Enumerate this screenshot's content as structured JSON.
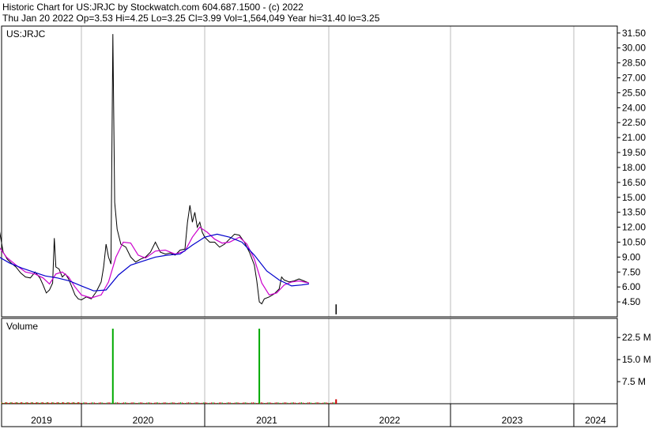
{
  "header": {
    "line1": "Historic Chart for US:JRJC by Stockwatch.com 604.687.1500 - (c) 2022",
    "line2": "Thu Jan 20 2022   Op=3.53   Hi=4.25   Lo=3.25   Cl=3.99   Vol=1,564,049   Year hi=31.40   lo=3.25"
  },
  "colors": {
    "price": "#000000",
    "ma_short": "#cc00cc",
    "ma_long": "#0000cc",
    "volume": "#00aa00",
    "volume_small": "#cc0000",
    "grid": "#bbbbbb"
  },
  "chart_data": [
    {
      "type": "line",
      "panel_label": "US:JRJC",
      "y_ticks": [
        "31.50",
        "30.00",
        "28.50",
        "27.00",
        "25.50",
        "24.00",
        "22.50",
        "21.00",
        "19.50",
        "18.00",
        "16.50",
        "15.00",
        "13.50",
        "12.00",
        "10.50",
        "9.00",
        "7.50",
        "6.00",
        "4.50"
      ],
      "ylim": [
        3.0,
        32.2
      ],
      "x_ticks": [
        "2019",
        "2020",
        "2021",
        "2022",
        "2023",
        "2024"
      ],
      "series": [
        {
          "values": [
            [
              2018.97,
              11.8
            ],
            [
              2019.02,
              9.5
            ],
            [
              2019.07,
              8.8
            ],
            [
              2019.12,
              8.4
            ],
            [
              2019.18,
              8.0
            ],
            [
              2019.24,
              7.4
            ],
            [
              2019.3,
              7.0
            ],
            [
              2019.36,
              6.9
            ],
            [
              2019.42,
              7.5
            ],
            [
              2019.48,
              6.9
            ],
            [
              2019.52,
              6.2
            ],
            [
              2019.56,
              5.4
            ],
            [
              2019.6,
              5.7
            ],
            [
              2019.64,
              6.4
            ],
            [
              2019.66,
              10.9
            ],
            [
              2019.68,
              8.0
            ],
            [
              2019.72,
              7.8
            ],
            [
              2019.76,
              7.0
            ],
            [
              2019.8,
              7.3
            ],
            [
              2019.84,
              6.8
            ],
            [
              2019.88,
              6.0
            ],
            [
              2019.92,
              5.2
            ],
            [
              2019.96,
              4.8
            ],
            [
              2020.0,
              4.7
            ],
            [
              2020.04,
              5.0
            ],
            [
              2020.08,
              4.8
            ],
            [
              2020.12,
              5.5
            ],
            [
              2020.16,
              6.5
            ],
            [
              2020.18,
              8.0
            ],
            [
              2020.2,
              10.3
            ],
            [
              2020.22,
              9.0
            ],
            [
              2020.24,
              8.3
            ],
            [
              2020.255,
              31.4
            ],
            [
              2020.27,
              14.5
            ],
            [
              2020.29,
              11.8
            ],
            [
              2020.32,
              10.3
            ],
            [
              2020.36,
              10.0
            ],
            [
              2020.4,
              9.0
            ],
            [
              2020.44,
              8.5
            ],
            [
              2020.48,
              8.8
            ],
            [
              2020.52,
              9.0
            ],
            [
              2020.56,
              9.5
            ],
            [
              2020.6,
              10.5
            ],
            [
              2020.64,
              9.5
            ],
            [
              2020.68,
              9.3
            ],
            [
              2020.72,
              9.4
            ],
            [
              2020.76,
              9.2
            ],
            [
              2020.8,
              9.7
            ],
            [
              2020.84,
              9.8
            ],
            [
              2020.86,
              12.5
            ],
            [
              2020.88,
              14.2
            ],
            [
              2020.9,
              12.5
            ],
            [
              2020.92,
              13.5
            ],
            [
              2020.94,
              12.0
            ],
            [
              2020.96,
              12.5
            ],
            [
              2020.98,
              11.5
            ],
            [
              2021.0,
              11.0
            ],
            [
              2021.04,
              10.5
            ],
            [
              2021.08,
              10.5
            ],
            [
              2021.12,
              10.0
            ],
            [
              2021.16,
              10.3
            ],
            [
              2021.2,
              10.8
            ],
            [
              2021.24,
              11.3
            ],
            [
              2021.28,
              11.2
            ],
            [
              2021.32,
              10.5
            ],
            [
              2021.36,
              9.5
            ],
            [
              2021.4,
              8.2
            ],
            [
              2021.42,
              6.6
            ],
            [
              2021.44,
              4.5
            ],
            [
              2021.46,
              4.3
            ],
            [
              2021.48,
              4.8
            ],
            [
              2021.52,
              5.0
            ],
            [
              2021.56,
              5.3
            ],
            [
              2021.6,
              5.8
            ],
            [
              2021.62,
              7.0
            ],
            [
              2021.64,
              6.7
            ],
            [
              2021.68,
              6.5
            ],
            [
              2021.72,
              6.6
            ],
            [
              2021.76,
              6.8
            ],
            [
              2021.8,
              6.6
            ],
            [
              2021.84,
              6.4
            ]
          ]
        },
        {
          "values": [
            [
              2018.97,
              10.0
            ],
            [
              2019.06,
              9.0
            ],
            [
              2019.18,
              8.2
            ],
            [
              2019.3,
              7.5
            ],
            [
              2019.42,
              7.3
            ],
            [
              2019.52,
              6.9
            ],
            [
              2019.6,
              6.3
            ],
            [
              2019.68,
              7.3
            ],
            [
              2019.76,
              7.5
            ],
            [
              2019.84,
              7.0
            ],
            [
              2019.92,
              6.0
            ],
            [
              2020.0,
              5.2
            ],
            [
              2020.08,
              4.9
            ],
            [
              2020.16,
              5.2
            ],
            [
              2020.22,
              6.5
            ],
            [
              2020.28,
              9.0
            ],
            [
              2020.34,
              10.5
            ],
            [
              2020.4,
              10.4
            ],
            [
              2020.46,
              9.2
            ],
            [
              2020.52,
              8.9
            ],
            [
              2020.6,
              9.6
            ],
            [
              2020.68,
              9.7
            ],
            [
              2020.76,
              9.3
            ],
            [
              2020.84,
              9.6
            ],
            [
              2020.9,
              11.0
            ],
            [
              2020.96,
              12.0
            ],
            [
              2021.02,
              11.5
            ],
            [
              2021.08,
              10.8
            ],
            [
              2021.14,
              10.4
            ],
            [
              2021.2,
              10.5
            ],
            [
              2021.28,
              11.0
            ],
            [
              2021.34,
              10.3
            ],
            [
              2021.4,
              8.8
            ],
            [
              2021.46,
              6.4
            ],
            [
              2021.52,
              5.2
            ],
            [
              2021.58,
              5.4
            ],
            [
              2021.64,
              6.2
            ],
            [
              2021.7,
              6.5
            ],
            [
              2021.76,
              6.6
            ],
            [
              2021.84,
              6.4
            ]
          ]
        },
        {
          "values": [
            [
              2018.97,
              9.0
            ],
            [
              2019.1,
              8.4
            ],
            [
              2019.25,
              7.9
            ],
            [
              2019.4,
              7.5
            ],
            [
              2019.55,
              7.1
            ],
            [
              2019.7,
              6.9
            ],
            [
              2019.85,
              6.6
            ],
            [
              2020.0,
              6.1
            ],
            [
              2020.1,
              5.6
            ],
            [
              2020.2,
              5.7
            ],
            [
              2020.3,
              7.2
            ],
            [
              2020.4,
              8.2
            ],
            [
              2020.5,
              8.6
            ],
            [
              2020.6,
              9.0
            ],
            [
              2020.7,
              9.2
            ],
            [
              2020.8,
              9.3
            ],
            [
              2020.9,
              10.2
            ],
            [
              2021.0,
              11.0
            ],
            [
              2021.1,
              11.3
            ],
            [
              2021.2,
              11.0
            ],
            [
              2021.3,
              10.5
            ],
            [
              2021.4,
              9.2
            ],
            [
              2021.5,
              7.6
            ],
            [
              2021.6,
              6.7
            ],
            [
              2021.7,
              6.1
            ],
            [
              2021.78,
              6.2
            ],
            [
              2021.84,
              6.3
            ]
          ]
        }
      ]
    },
    {
      "type": "bar",
      "panel_label": "Volume",
      "y_ticks": [
        "22.5 M",
        "15.0 M",
        "7.5 M"
      ],
      "ylim": [
        0,
        29
      ],
      "x": [
        2020.255,
        2021.44
      ],
      "values": [
        25.5,
        25.5
      ]
    }
  ]
}
